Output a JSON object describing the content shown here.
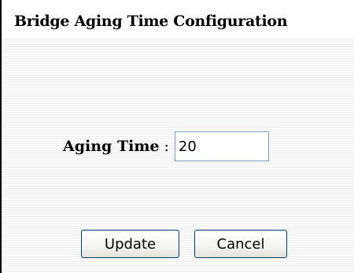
{
  "page": {
    "title": "Bridge Aging Time Configuration"
  },
  "form": {
    "aging_time_label": "Aging Time",
    "colon": ":",
    "aging_time_value": "20"
  },
  "buttons": {
    "update_label": "Update",
    "cancel_label": "Cancel"
  }
}
